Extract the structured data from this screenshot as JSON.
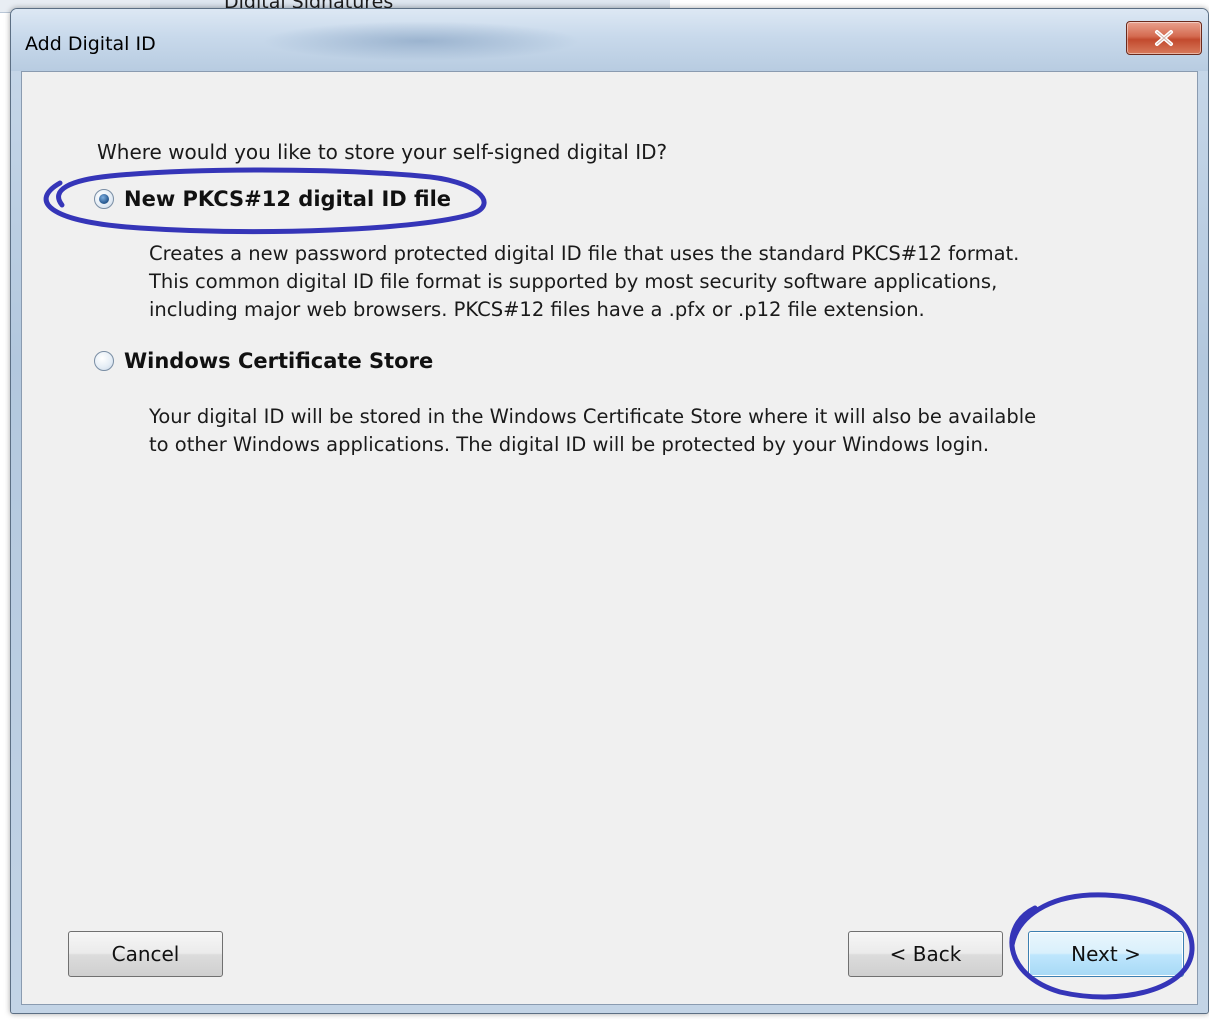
{
  "background_window": {
    "title": "Digital Signatures"
  },
  "dialog": {
    "title": "Add Digital ID",
    "close_icon": "close-icon"
  },
  "content": {
    "question": "Where would you like to store your self-signed digital ID?",
    "options": [
      {
        "label": "New PKCS#12 digital ID file",
        "selected": true,
        "description": [
          "Creates a new password protected digital ID file that uses the standard PKCS#12 format.",
          "This common digital ID file format is supported by most security software applications,",
          "including major web browsers. PKCS#12 files have a .pfx or .p12 file extension."
        ]
      },
      {
        "label": "Windows Certificate Store",
        "selected": false,
        "description": [
          "Your digital ID will be stored in the Windows Certificate Store where it will also be available",
          "to other Windows applications. The digital ID will be protected by your Windows login."
        ]
      }
    ]
  },
  "buttons": {
    "cancel": "Cancel",
    "back": "< Back",
    "next": "Next >"
  },
  "colors": {
    "annotation": "#3535b8",
    "content_bg": "#f0f0f0",
    "close_button": "#c94c30"
  }
}
